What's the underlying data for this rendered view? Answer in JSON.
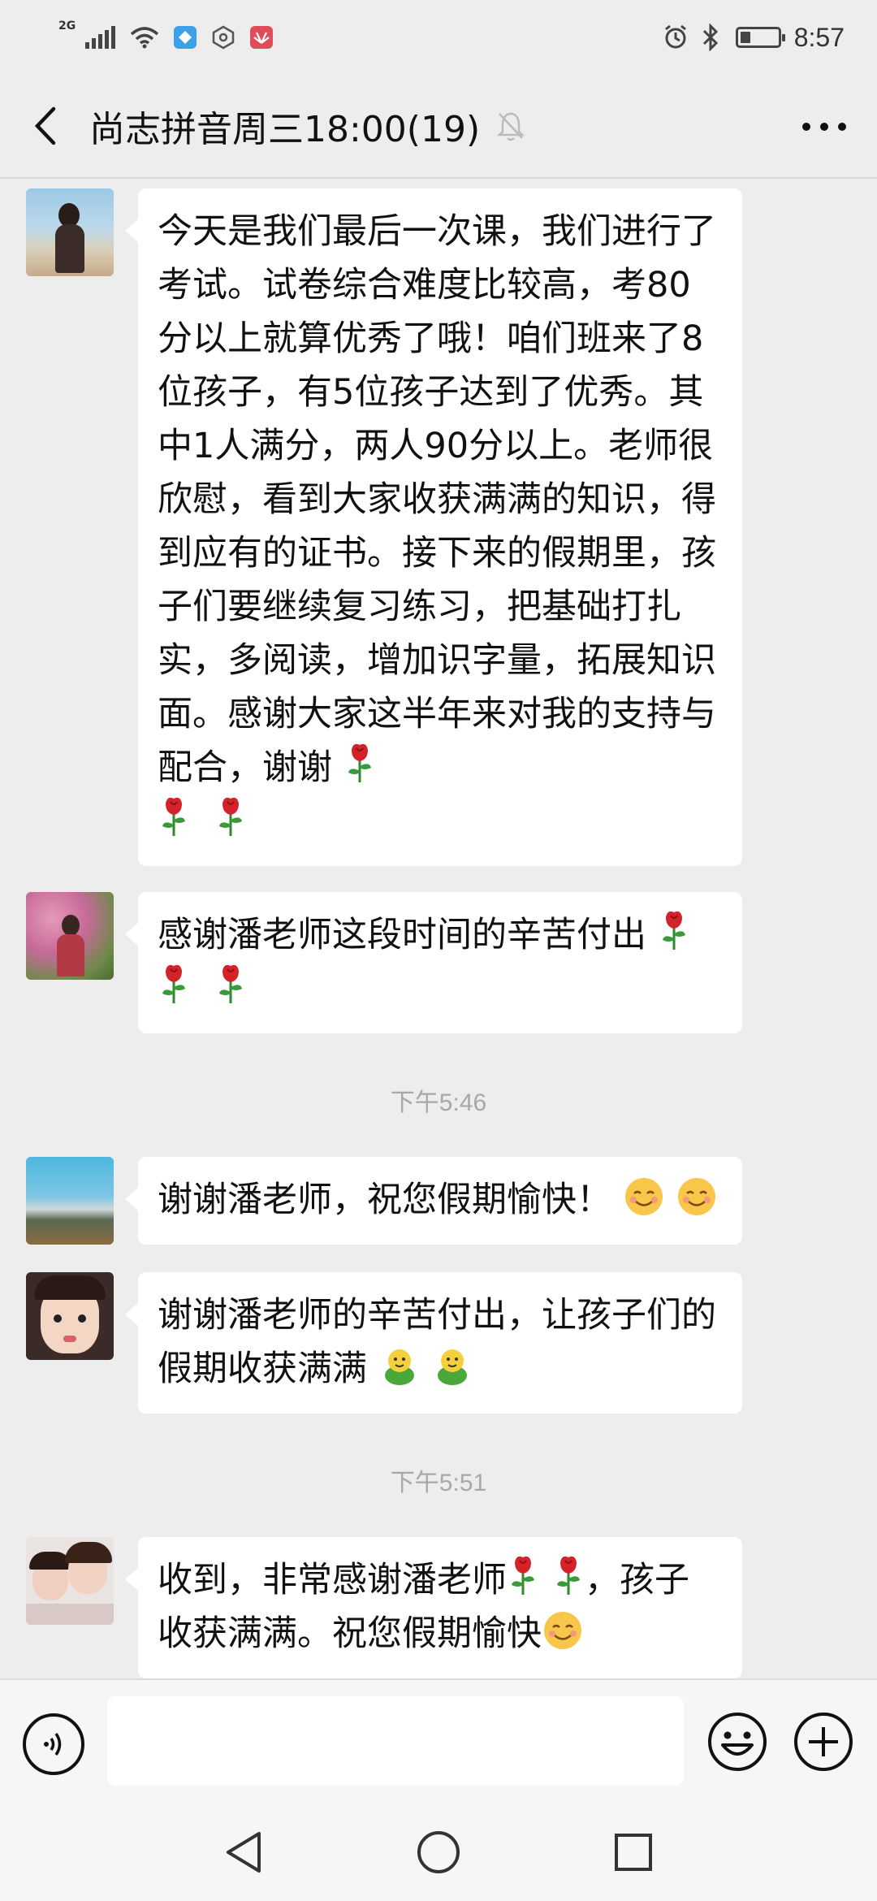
{
  "status_bar": {
    "network": "2G",
    "time": "8:57"
  },
  "header": {
    "title": "尚志拼音周三18:00(19)"
  },
  "messages": [
    {
      "text": "今天是我们最后一次课，我们进行了考试。试卷综合难度比较高，考80分以上就算优秀了哦！咱们班来了8位孩子，有5位孩子达到了优秀。其中1人满分，两人90分以上。老师很欣慰，看到大家收获满满的知识，得到应有的证书。接下来的假期里，孩子们要继续复习练习，把基础打扎实，多阅读，增加识字量，拓展知识面。感谢大家这半年来对我的支持与配合，谢谢"
    },
    {
      "text": "感谢潘老师这段时间的辛苦付出"
    },
    {
      "text": "谢谢潘老师，祝您假期愉快！"
    },
    {
      "text": "谢谢潘老师的辛苦付出，让孩子们的假期收获满满"
    },
    {
      "text_a": "收到，非常感谢潘老师",
      "text_b": "，孩子收获满满。祝您假期愉快"
    }
  ],
  "timestamps": [
    "下午5:46",
    "下午5:51"
  ],
  "icons": {
    "rose": "rose-emoji",
    "smile": "smiling-face-emoji",
    "green": "green-figure-emoji"
  },
  "colors": {
    "background": "#ededed",
    "bubble": "#ffffff",
    "timestamp": "#a8a8a8"
  }
}
